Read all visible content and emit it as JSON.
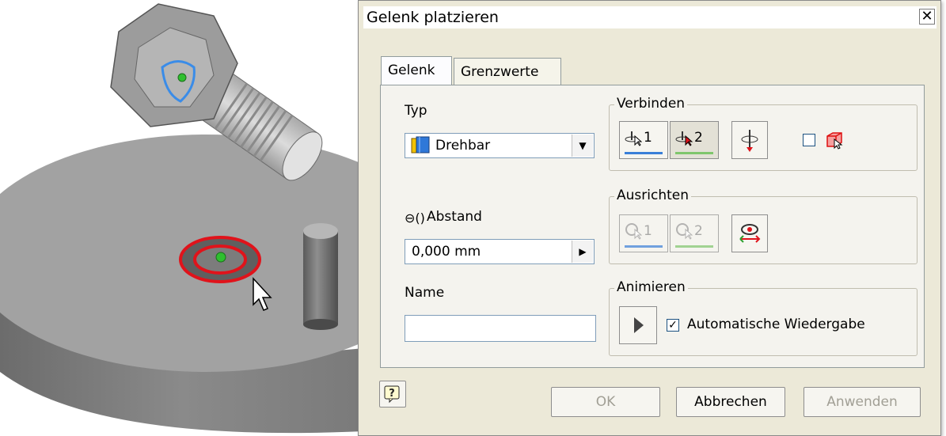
{
  "dialog": {
    "title": "Gelenk platzieren",
    "close_glyph": "✕",
    "tabs": [
      {
        "label": "Gelenk",
        "active": true
      },
      {
        "label": "Grenzwerte",
        "active": false
      }
    ],
    "typ": {
      "label": "Typ",
      "selected": "Drehbar",
      "icon": "revolute-joint-icon"
    },
    "verbinden": {
      "title": "Verbinden",
      "btn1_label": "1",
      "btn2_label": "2",
      "btn1_underline": "#3a7fd8",
      "btn2_underline": "#7fc66c",
      "flip_icon": "flip-direction-icon",
      "checkbox_checked": false,
      "cube_icon": "red-cube-select-icon"
    },
    "abstand": {
      "label": "Abstand",
      "value": "0,000 mm",
      "icon": "offset-icon"
    },
    "ausrichten": {
      "title": "Ausrichten",
      "btn1_label": "1",
      "btn2_label": "2",
      "swap_icon": "swap-alignment-icon"
    },
    "name": {
      "label": "Name",
      "value": ""
    },
    "animieren": {
      "title": "Animieren",
      "play_icon": "play-icon",
      "auto_label": "Automatische Wiedergabe",
      "auto_checked": true
    },
    "footer": {
      "help_icon": "help-icon",
      "ok_label": "OK",
      "cancel_label": "Abbrechen",
      "apply_label": "Anwenden"
    }
  },
  "colors": {
    "dialog_bg": "#ece9d8",
    "highlight_red": "#e0131b",
    "point_green": "#2fbf2f",
    "selection_blue": "#3a8ce8"
  }
}
